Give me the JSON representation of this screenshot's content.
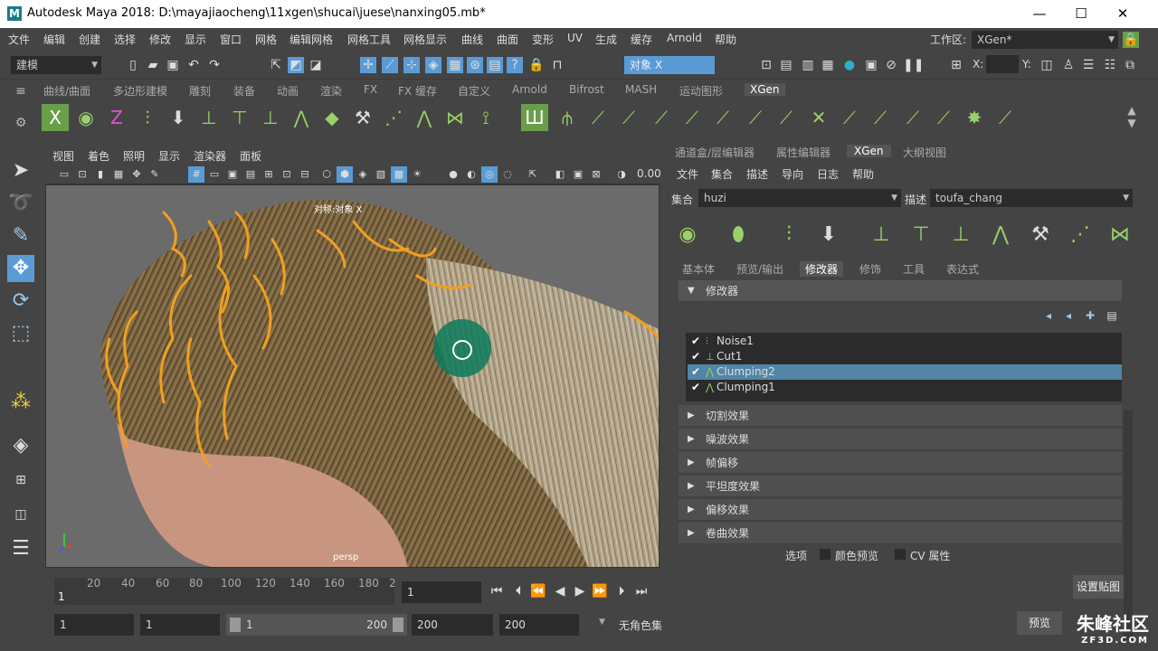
{
  "window": {
    "title": "Autodesk Maya 2018: D:\\mayajiaocheng\\11xgen\\shucai\\juese\\nanxing05.mb*",
    "logo_letter": "M",
    "minimize": "—",
    "maximize": "☐",
    "close": "✕"
  },
  "menu": {
    "items": [
      "文件",
      "编辑",
      "创建",
      "选择",
      "修改",
      "显示",
      "窗口",
      "网格",
      "编辑网格",
      "网格工具",
      "网格显示",
      "曲线",
      "曲面",
      "变形",
      "UV",
      "生成",
      "缓存",
      "Arnold",
      "帮助"
    ],
    "workspace_label": "工作区:",
    "workspace_value": "XGen*"
  },
  "statusline": {
    "mode": "建模",
    "symmetry": "对象 X",
    "x_label": "X:",
    "y_label": "Y:"
  },
  "shelf": {
    "tabs": [
      "曲线/曲面",
      "多边形建模",
      "雕刻",
      "装备",
      "动画",
      "渲染",
      "FX",
      "FX 缓存",
      "自定义",
      "Arnold",
      "Bifrost",
      "MASH",
      "运动图形",
      "XGen"
    ],
    "active_tab": "XGen"
  },
  "viewport": {
    "menu": [
      "视图",
      "着色",
      "照明",
      "显示",
      "渲染器",
      "面板"
    ],
    "value": "0.00",
    "symmetry_label": "对称:对象 X",
    "camera": "persp"
  },
  "timeline": {
    "ticks": [
      "20",
      "40",
      "60",
      "80",
      "100",
      "120",
      "140",
      "160",
      "180",
      "2"
    ],
    "start_frame": "1",
    "current_frame": "1"
  },
  "range": {
    "start": "1",
    "playback_start": "1",
    "slider_start": "1",
    "slider_end": "200",
    "playback_end": "200",
    "end": "200",
    "char_set": "无角色集"
  },
  "rightpanel": {
    "tabs": [
      "通道盒/层编辑器",
      "属性编辑器",
      "XGen",
      "大纲视图"
    ],
    "active_tab": "XGen",
    "menu": [
      "文件",
      "集合",
      "描述",
      "导向",
      "日志",
      "帮助"
    ],
    "collection_label": "集合",
    "collection_value": "huzi",
    "description_label": "描述",
    "description_value": "toufa_chang",
    "subtabs": [
      "基本体",
      "预览/输出",
      "修改器",
      "修饰",
      "工具",
      "表达式"
    ],
    "active_subtab": "修改器",
    "section_title": "修改器",
    "modifiers": [
      {
        "name": "Noise1",
        "checked": "✔",
        "selected": false
      },
      {
        "name": "Cut1",
        "checked": "✔",
        "selected": false
      },
      {
        "name": "Clumping2",
        "checked": "✔",
        "selected": true
      },
      {
        "name": "Clumping1",
        "checked": "✔",
        "selected": false
      }
    ],
    "effects": [
      "切割效果",
      "噪波效果",
      "帧偏移",
      "平坦度效果",
      "偏移效果",
      "卷曲效果"
    ],
    "options_label": "选项",
    "color_preview": "颜色预览",
    "cv_attr": "CV 属性",
    "set_map_button": "设置贴图",
    "preview_button": "预览"
  },
  "watermark": {
    "main": "朱峰社区",
    "sub": "ZF3D.COM"
  },
  "colors": {
    "selection": "#5285a6",
    "shelf_green": "#9ad06a",
    "hair_guide": "#f0a020",
    "accent_blue": "#5b9bd5"
  }
}
